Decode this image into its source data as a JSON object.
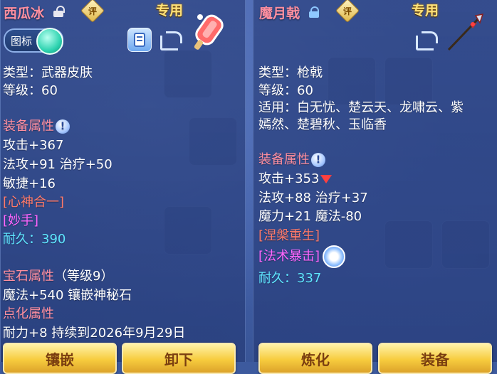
{
  "left": {
    "title": "西瓜冰",
    "rate_label": "评",
    "exclusive": "专用",
    "icon_toggle_label": "图标",
    "lines": {
      "type": "类型：武器皮肤",
      "level": "等级：60",
      "equip_header": "装备属性",
      "attack": "攻击+367",
      "magic": "法攻+91 治疗+50",
      "agility": "敏捷+16",
      "skill1": "[心神合一]",
      "skill2": "[妙手]",
      "durability_label": "耐久：",
      "durability_value": "390",
      "gem_header": "宝石属性",
      "gem_level": "（等级9）",
      "gem_line": "魔法+540 镶嵌神秘石",
      "enchant_header": "点化属性",
      "enchant_line": "耐力+8 持续到2026年9月29日"
    },
    "buttons": {
      "inlay": "镶嵌",
      "unequip": "卸下"
    }
  },
  "right": {
    "title": "魔月戟",
    "rate_label": "评",
    "exclusive": "专用",
    "lines": {
      "type": "类型：枪戟",
      "level": "等级：60",
      "for1": "适用：白无忧、楚云天、龙啸云、紫",
      "for2": "嫣然、楚碧秋、玉临香",
      "equip_header": "装备属性",
      "attack": "攻击+353",
      "magic": "法攻+88 治疗+37",
      "mana": "魔力+21 魔法-80",
      "skill1": "[涅槃重生]",
      "skill2": "[法术暴击]",
      "durability_label": "耐久：",
      "durability_value": "337"
    },
    "buttons": {
      "refine": "炼化",
      "equip": "装备"
    }
  },
  "colors": {
    "section": "#ff8fa0",
    "cyan": "#5fe6ff",
    "gold": "#ffe27a",
    "skill_red": "#ff7a6a",
    "skill_magenta": "#ff66ff"
  },
  "icons": [
    "lock-icon",
    "rate-icon",
    "info-icon",
    "share-icon",
    "refresh-icon",
    "down-arrow-icon"
  ]
}
